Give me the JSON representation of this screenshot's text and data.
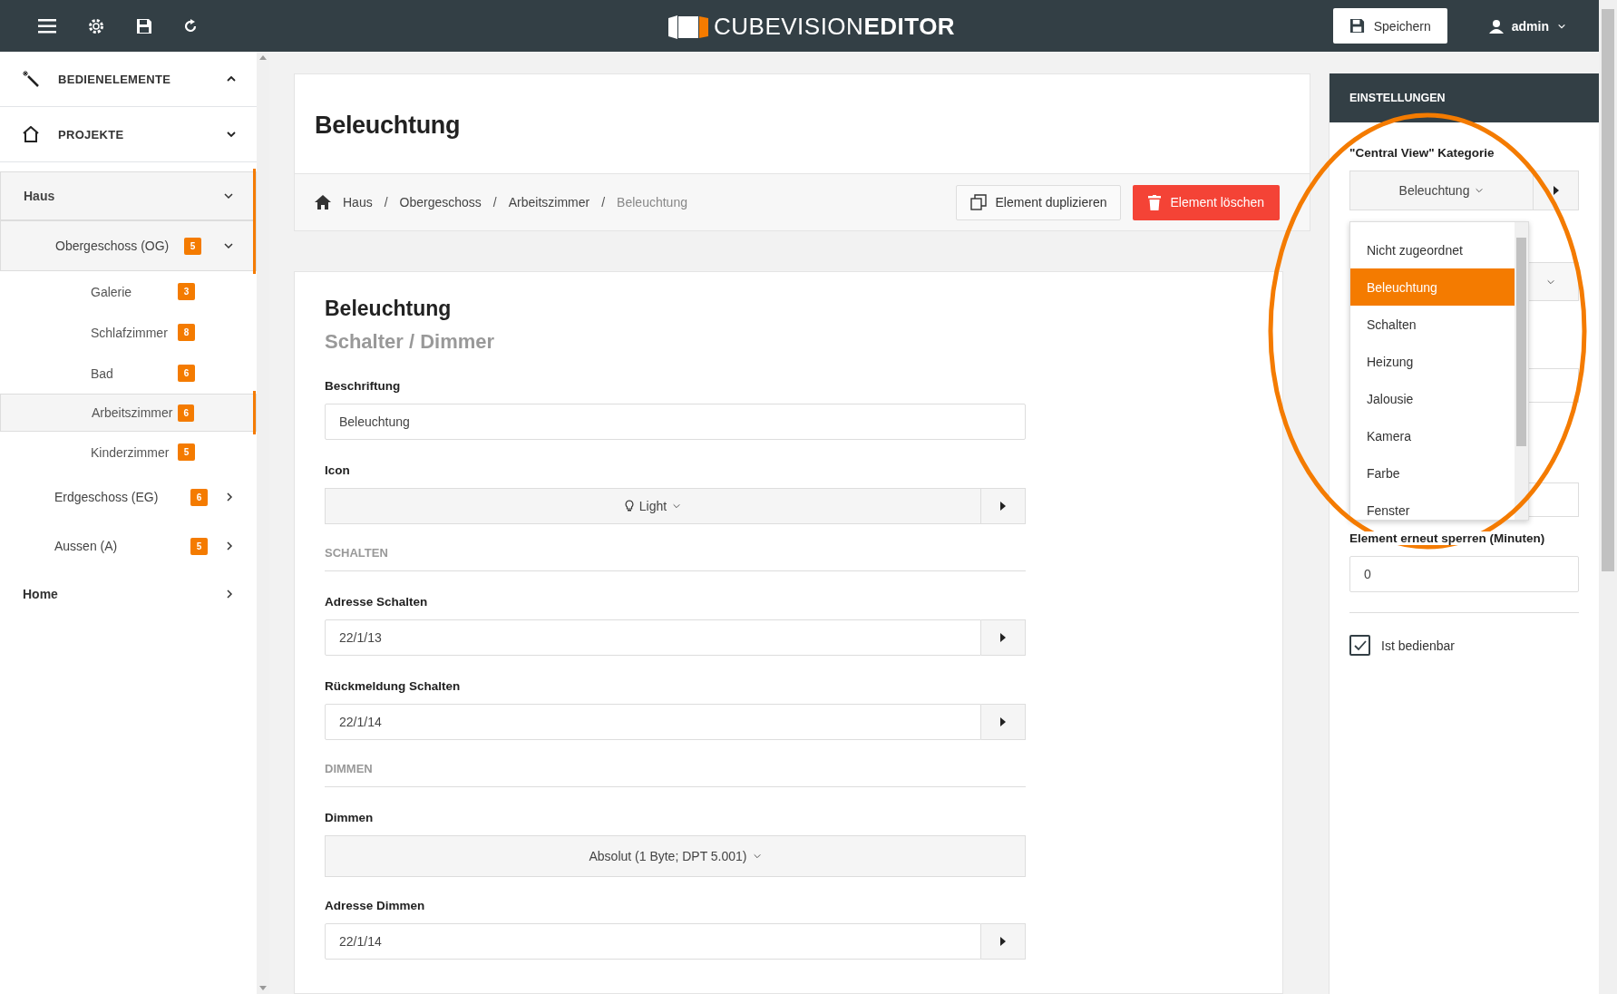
{
  "app_bar": {
    "logo": {
      "light": "CUBEVISION",
      "bold": "EDITOR"
    },
    "save_button": "Speichern",
    "user": "admin"
  },
  "sidebar": {
    "sections": [
      {
        "label": "BEDIENELEMENTE",
        "expanded": true
      },
      {
        "label": "PROJEKTE",
        "expanded": false
      }
    ],
    "tree": [
      {
        "label": "Haus",
        "selected": true,
        "expanded": true,
        "children": [
          {
            "label": "Obergeschoss (OG)",
            "count": "5",
            "selected": true,
            "expanded": true,
            "children": [
              {
                "label": "Galerie",
                "count": "3",
                "selected": false
              },
              {
                "label": "Schlafzimmer",
                "count": "8",
                "selected": false
              },
              {
                "label": "Bad",
                "count": "6",
                "selected": false
              },
              {
                "label": "Arbeitszimmer",
                "count": "6",
                "selected": true
              },
              {
                "label": "Kinderzimmer",
                "count": "5",
                "selected": false
              }
            ]
          },
          {
            "label": "Erdgeschoss (EG)",
            "count": "6",
            "selected": false,
            "expanded": false
          },
          {
            "label": "Aussen (A)",
            "count": "5",
            "selected": false,
            "expanded": false
          }
        ]
      },
      {
        "label": "Home",
        "selected": false,
        "expanded": false
      }
    ]
  },
  "page": {
    "title": "Beleuchtung",
    "breadcrumb_separator": "/",
    "breadcrumb": [
      "Haus",
      "Obergeschoss",
      "Arbeitszimmer",
      "Beleuchtung"
    ],
    "duplicate_button": "Element duplizieren",
    "delete_button": "Element löschen"
  },
  "form": {
    "heading": "Beleuchtung",
    "subheading": "Schalter / Dimmer",
    "fields": [
      {
        "kind": "text",
        "label": "Beschriftung",
        "value": "Beleuchtung"
      },
      {
        "kind": "icon-select",
        "label": "Icon",
        "value": "Light"
      },
      {
        "kind": "section",
        "label": "SCHALTEN"
      },
      {
        "kind": "address",
        "label": "Adresse Schalten",
        "value": "22/1/13"
      },
      {
        "kind": "address",
        "label": "Rückmeldung Schalten",
        "value": "22/1/14"
      },
      {
        "kind": "section",
        "label": "DIMMEN"
      },
      {
        "kind": "select",
        "label": "Dimmen",
        "value": "Absolut (1 Byte; DPT 5.001)"
      },
      {
        "kind": "address",
        "label": "Adresse Dimmen",
        "value": "22/1/14"
      }
    ]
  },
  "settings": {
    "title": "EINSTELLUNGEN",
    "category_label": "\"Central View\" Kategorie",
    "category_value": "Beleuchtung",
    "options": [
      {
        "label": "Nicht zugeordnet",
        "selected": false
      },
      {
        "label": "Beleuchtung",
        "selected": true
      },
      {
        "label": "Schalten",
        "selected": false
      },
      {
        "label": "Heizung",
        "selected": false
      },
      {
        "label": "Jalousie",
        "selected": false
      },
      {
        "label": "Kamera",
        "selected": false
      },
      {
        "label": "Farbe",
        "selected": false
      },
      {
        "label": "Fenster",
        "selected": false
      }
    ],
    "lock_label": "Element erneut sperren (Minuten)",
    "lock_value": "0",
    "operable": {
      "label": "Ist bedienbar",
      "checked": true
    }
  }
}
